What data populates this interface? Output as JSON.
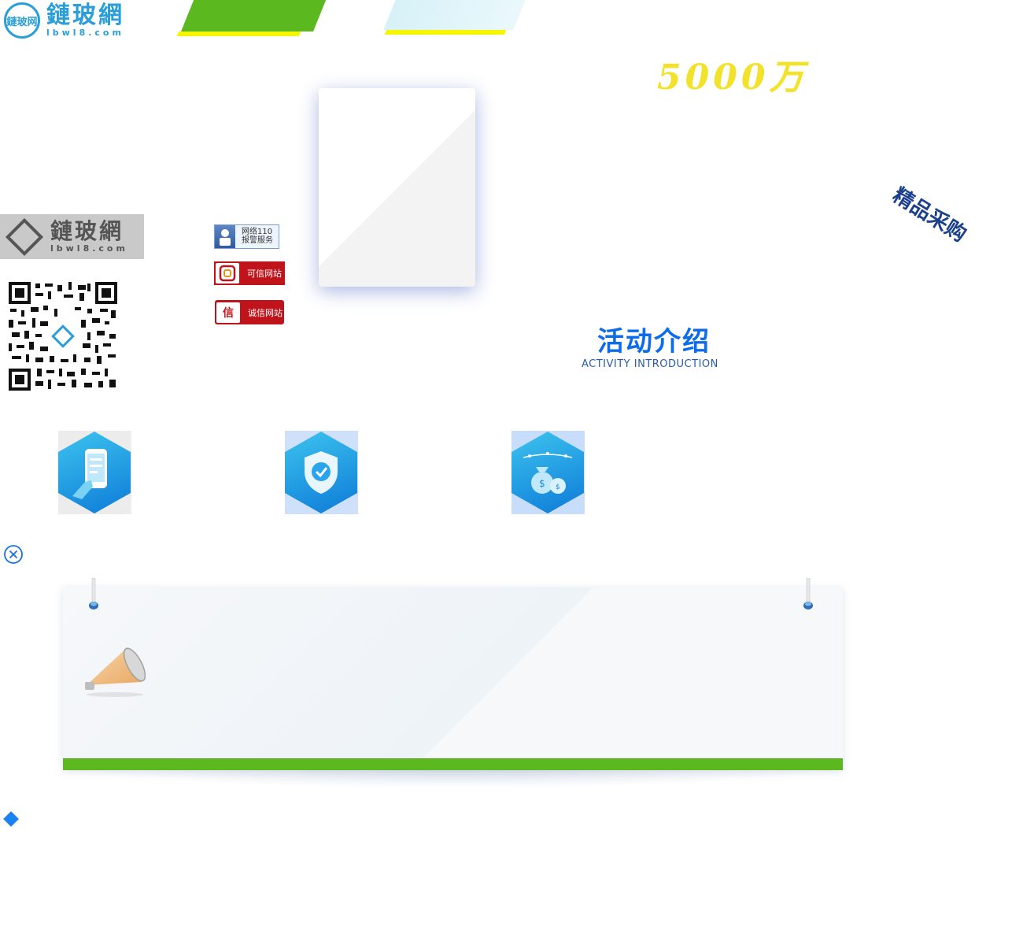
{
  "header": {
    "logo_cn": "鏈玻網",
    "logo_en": "lbwl8.com",
    "logo_badge": "鏈玻网"
  },
  "hero": {
    "headline": "5000万",
    "tag": "精品采购"
  },
  "left_panel": {
    "logo_cn": "鏈玻網",
    "logo_en": "lbwl8.com"
  },
  "badges": {
    "police_110": "网络110 报警服务",
    "credit_site": "可信网站",
    "honest_site": "诚信网站"
  },
  "activity": {
    "title": "活动介绍",
    "subtitle": "ACTIVITY INTRODUCTION"
  },
  "icons": {
    "feature_1": "phone-hand-icon",
    "feature_2": "shield-check-icon",
    "feature_3": "money-bags-icon",
    "close": "close-icon",
    "bullet": "diamond-icon"
  },
  "colors": {
    "primary_blue": "#0c6cec",
    "green": "#5bb81f",
    "yellow": "#f5f500",
    "badge_red": "#c0141c"
  }
}
